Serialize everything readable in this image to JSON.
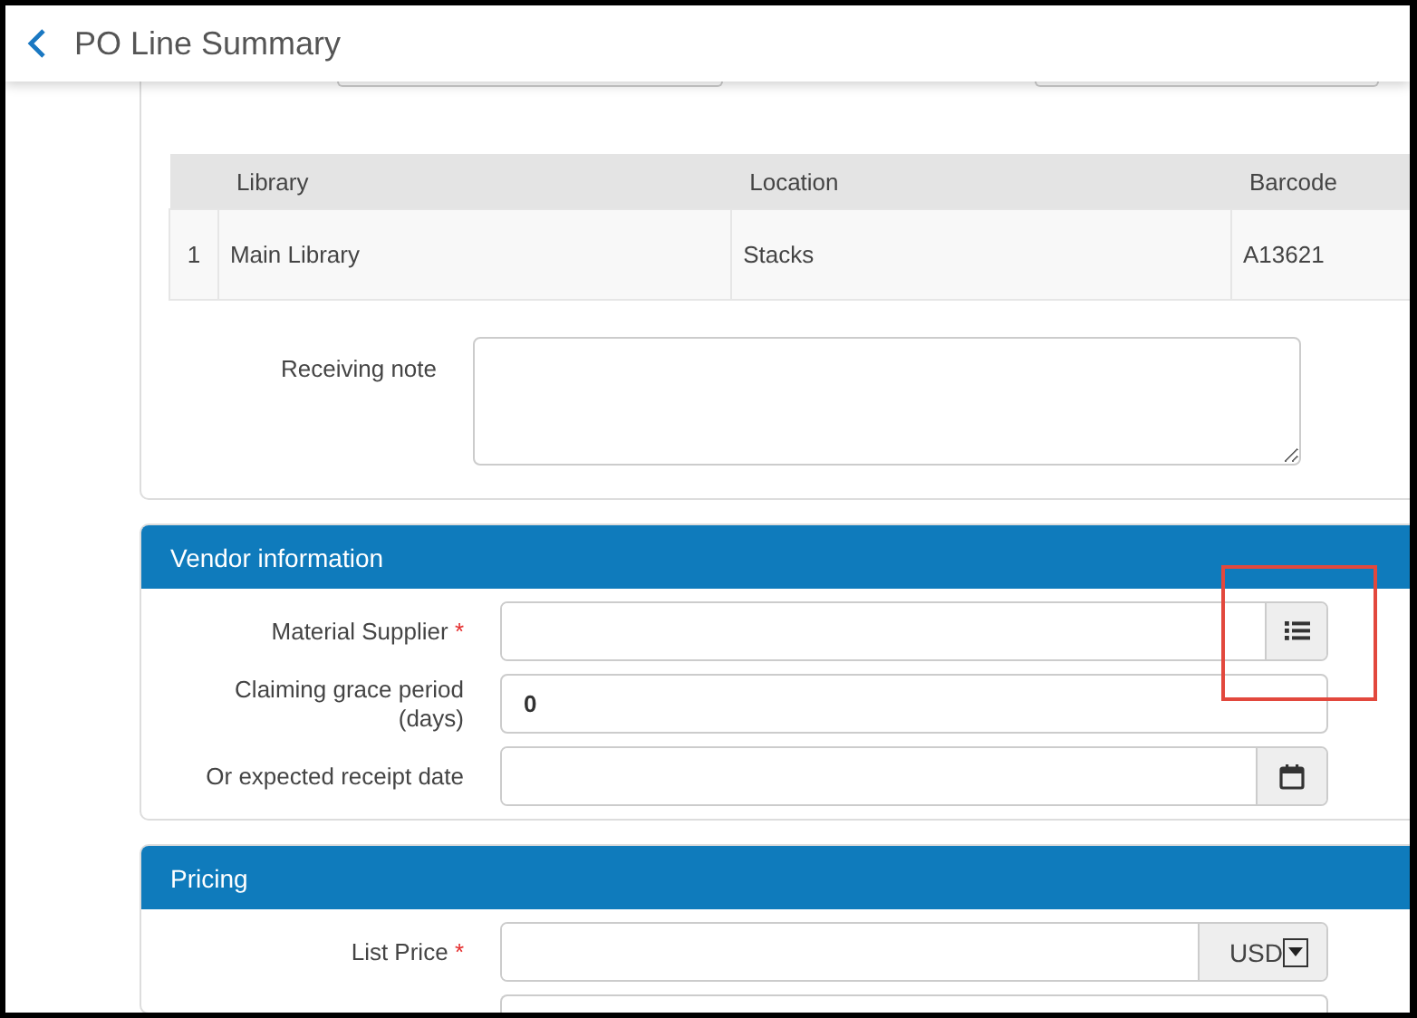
{
  "header": {
    "title": "PO Line Summary"
  },
  "items_table": {
    "columns": [
      "Library",
      "Location",
      "Barcode"
    ],
    "rows": [
      {
        "index": "1",
        "cells": [
          "Main Library",
          "Stacks",
          "A13621"
        ]
      }
    ]
  },
  "receiving_note": {
    "label": "Receiving note"
  },
  "sections": [
    {
      "title": "Vendor information",
      "fields": [
        {
          "kind": "lookup",
          "label": "Material Supplier",
          "required_mark": "*"
        },
        {
          "kind": "text",
          "label": "Claiming grace period (days)",
          "value": "0"
        },
        {
          "kind": "date",
          "label": "Or expected receipt date"
        }
      ]
    },
    {
      "title": "Pricing",
      "fields": [
        {
          "kind": "currency",
          "label": "List Price",
          "required_mark": "*",
          "addon": "USD"
        },
        {
          "kind": "partial"
        }
      ]
    }
  ]
}
